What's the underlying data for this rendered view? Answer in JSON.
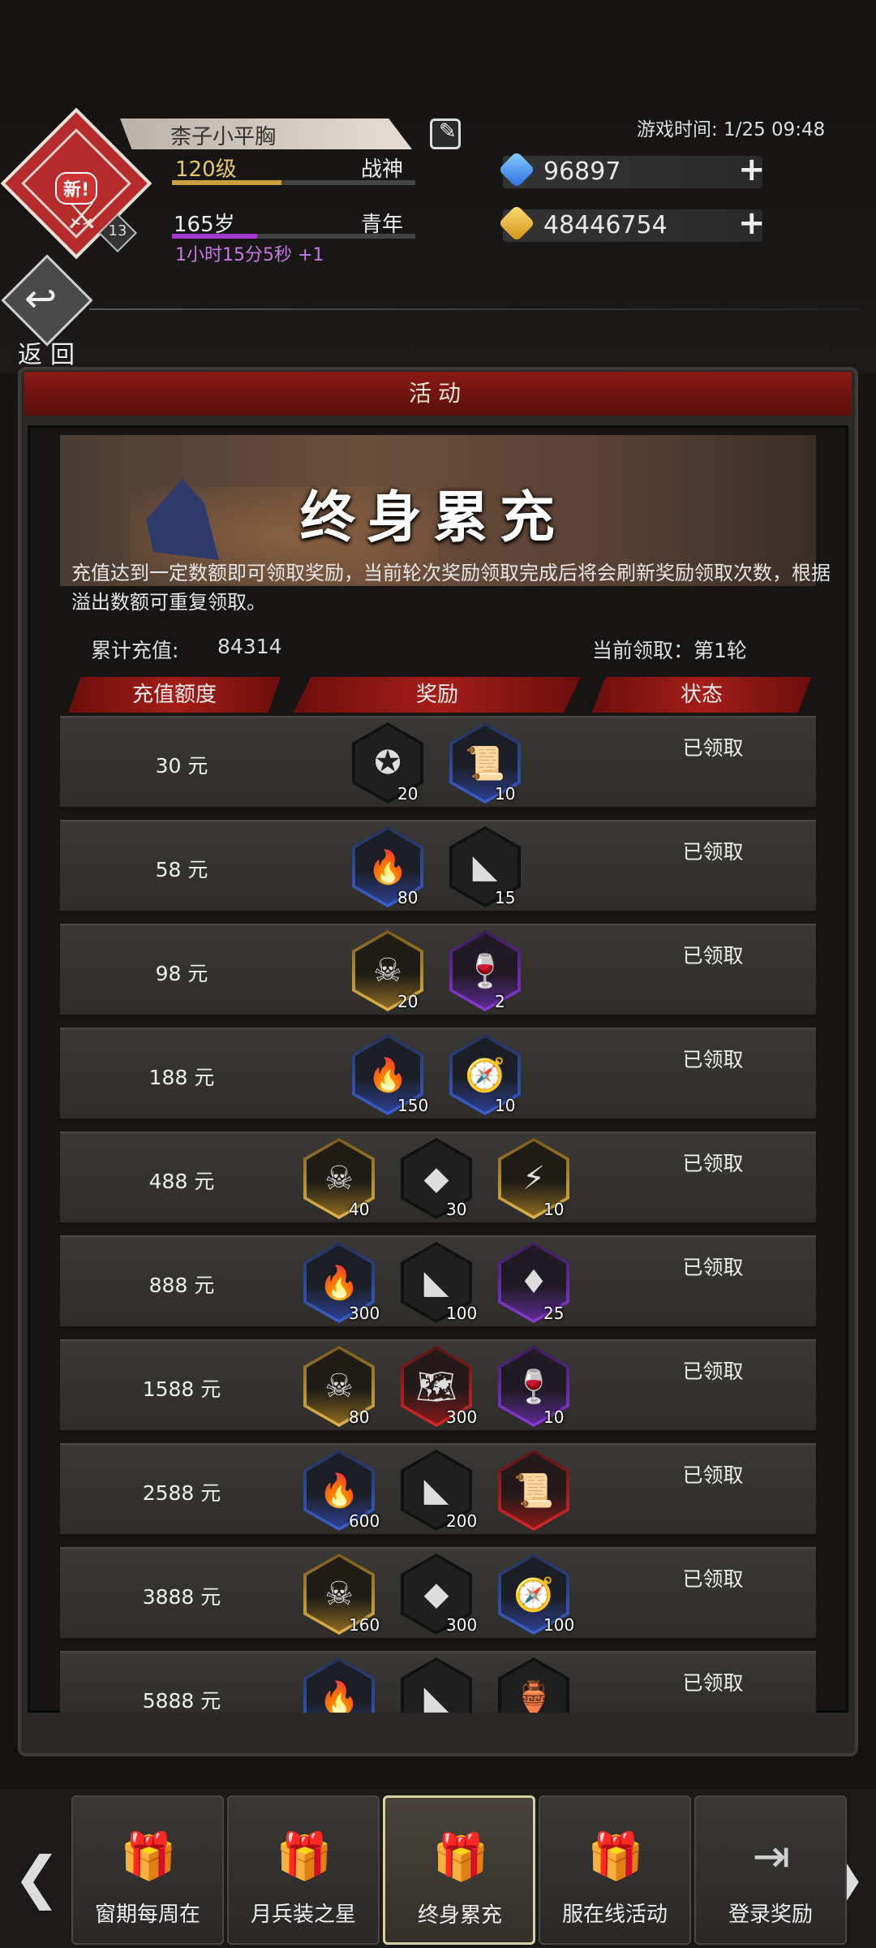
{
  "player": {
    "name": "柰子小平胸",
    "level": "120级",
    "rank": "战神",
    "age": "165岁",
    "age_stage": "青年",
    "timer": "1小时15分5秒 +1",
    "new_badge": "新!",
    "emblem_level": "13"
  },
  "game_time": "游戏时间: 1/25 09:48",
  "currency": {
    "diamonds": "96897",
    "gold": "48446754"
  },
  "back_label": "返回",
  "panel_title": "活动",
  "event": {
    "title": "终身累充",
    "description": "充值达到一定数额即可领取奖励，当前轮次奖励领取完成后将会刷新奖励领取次数，根据溢出数额可重复领取。",
    "accum_label": "累计充值:",
    "accum_value": "84314",
    "round": "当前领取：第1轮"
  },
  "columns": {
    "amount": "充值额度",
    "reward": "奖励",
    "status": "状态"
  },
  "rows": [
    {
      "amount": "30 元",
      "status": "已领取",
      "rewards": [
        {
          "icon": "silver-coin-icon",
          "glyph": "✪",
          "frame": "grey",
          "qty": "20"
        },
        {
          "icon": "scroll-icon",
          "glyph": "📜",
          "frame": "blue",
          "qty": "10"
        }
      ]
    },
    {
      "amount": "58 元",
      "status": "已领取",
      "rewards": [
        {
          "icon": "torch-icon",
          "glyph": "🔥",
          "frame": "blue",
          "qty": "80"
        },
        {
          "icon": "fragment-icon",
          "glyph": "◣",
          "frame": "grey",
          "qty": "15"
        }
      ]
    },
    {
      "amount": "98 元",
      "status": "已领取",
      "rewards": [
        {
          "icon": "skull-icon",
          "glyph": "☠",
          "frame": "gold",
          "qty": "20"
        },
        {
          "icon": "chalice-icon",
          "glyph": "🍷",
          "frame": "purple",
          "qty": "2"
        }
      ]
    },
    {
      "amount": "188 元",
      "status": "已领取",
      "rewards": [
        {
          "icon": "torch-icon",
          "glyph": "🔥",
          "frame": "blue",
          "qty": "150"
        },
        {
          "icon": "compass-icon",
          "glyph": "🧭",
          "frame": "blue",
          "qty": "10"
        }
      ]
    },
    {
      "amount": "488 元",
      "status": "已领取",
      "rewards": [
        {
          "icon": "skull-icon",
          "glyph": "☠",
          "frame": "gold",
          "qty": "40"
        },
        {
          "icon": "crystal-icon",
          "glyph": "◆",
          "frame": "grey",
          "qty": "30"
        },
        {
          "icon": "tablet-icon",
          "glyph": "⚡",
          "frame": "gold",
          "qty": "10"
        }
      ]
    },
    {
      "amount": "888 元",
      "status": "已领取",
      "rewards": [
        {
          "icon": "torch-icon",
          "glyph": "🔥",
          "frame": "blue",
          "qty": "300"
        },
        {
          "icon": "fragment-icon",
          "glyph": "◣",
          "frame": "grey",
          "qty": "100"
        },
        {
          "icon": "crystal-cluster-icon",
          "glyph": "♦",
          "frame": "purple",
          "qty": "25"
        }
      ]
    },
    {
      "amount": "1588 元",
      "status": "已领取",
      "rewards": [
        {
          "icon": "skull-icon",
          "glyph": "☠",
          "frame": "gold",
          "qty": "80"
        },
        {
          "icon": "map-scroll-icon",
          "glyph": "🗺",
          "frame": "red",
          "qty": "300"
        },
        {
          "icon": "chalice-icon",
          "glyph": "🍷",
          "frame": "purple",
          "qty": "10"
        }
      ]
    },
    {
      "amount": "2588 元",
      "status": "已领取",
      "rewards": [
        {
          "icon": "torch-icon",
          "glyph": "🔥",
          "frame": "blue",
          "qty": "600"
        },
        {
          "icon": "fragment-icon",
          "glyph": "◣",
          "frame": "grey",
          "qty": "200"
        },
        {
          "icon": "bonus-scroll-icon",
          "glyph": "📜",
          "frame": "red",
          "qty": ""
        }
      ]
    },
    {
      "amount": "3888 元",
      "status": "已领取",
      "rewards": [
        {
          "icon": "skull-icon",
          "glyph": "☠",
          "frame": "gold",
          "qty": "160"
        },
        {
          "icon": "crystal-icon",
          "glyph": "◆",
          "frame": "grey",
          "qty": "300"
        },
        {
          "icon": "compass-icon",
          "glyph": "🧭",
          "frame": "blue",
          "qty": "100"
        }
      ]
    },
    {
      "amount": "5888 元",
      "status": "已领取",
      "rewards": [
        {
          "icon": "torch-icon",
          "glyph": "🔥",
          "frame": "blue",
          "qty": ""
        },
        {
          "icon": "fragment-icon",
          "glyph": "◣",
          "frame": "grey",
          "qty": ""
        },
        {
          "icon": "bottle-icon",
          "glyph": "🏺",
          "frame": "grey",
          "qty": ""
        }
      ]
    }
  ],
  "tabs": [
    {
      "label": "窗期每周在",
      "active": false
    },
    {
      "label": "月兵装之星",
      "active": false
    },
    {
      "label": "终身累充",
      "active": true
    },
    {
      "label": "服在线活动",
      "active": false
    },
    {
      "label": "登录奖励",
      "active": false
    }
  ],
  "tab_icons": {
    "gift": "🎁",
    "login": "⇥"
  },
  "colors": {
    "accent_red": "#a51d18",
    "panel": "#2b2926"
  }
}
